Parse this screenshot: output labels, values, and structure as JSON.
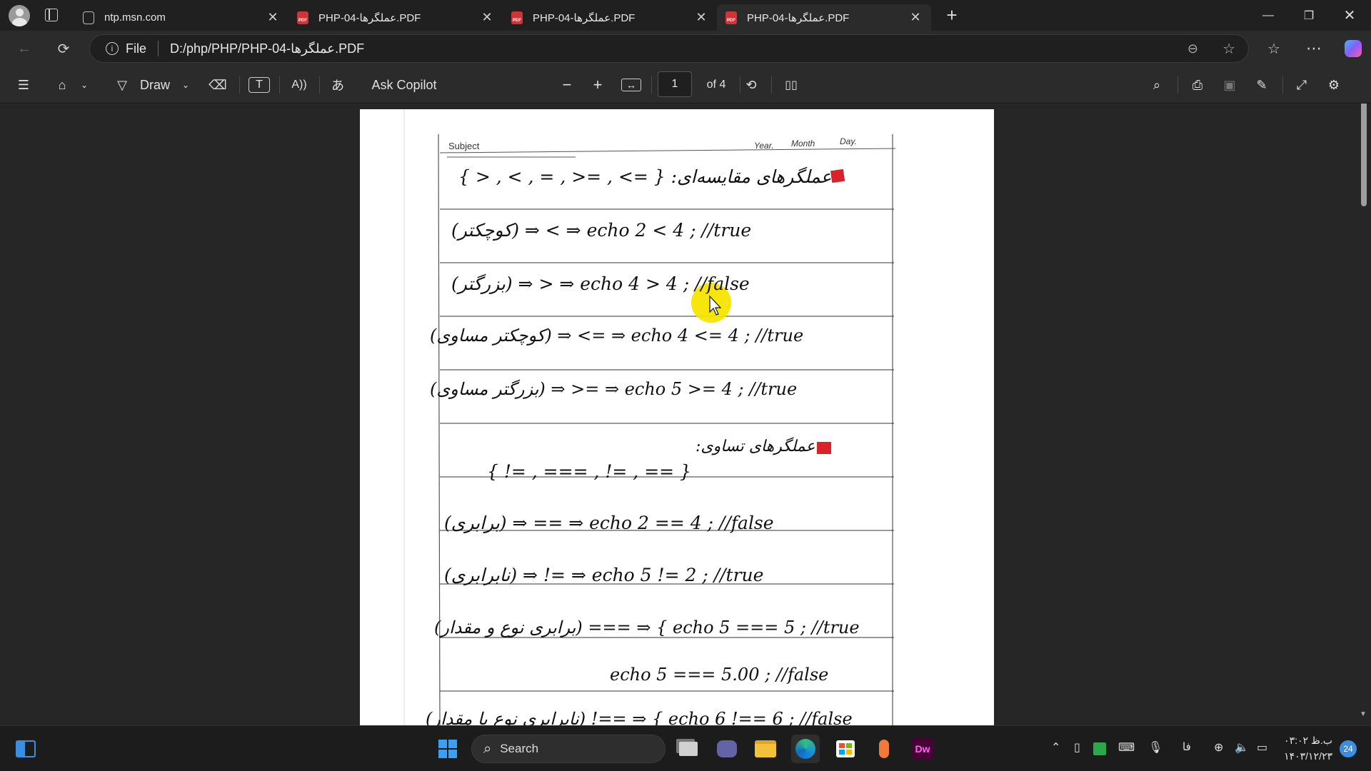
{
  "tabs": [
    {
      "title": "ntp.msn.com",
      "icon": "msn-icon",
      "active": false
    },
    {
      "title": "PHP-04-عملگرها.PDF",
      "icon": "pdf-icon",
      "active": false
    },
    {
      "title": "PHP-04-عملگرها.PDF",
      "icon": "pdf-icon",
      "active": false
    },
    {
      "title": "PHP-04-عملگرها.PDF",
      "icon": "pdf-icon",
      "active": true
    }
  ],
  "address": {
    "scheme_label": "File",
    "url": "D:/php/PHP/PHP-04-عملگرها.PDF"
  },
  "pdf_toolbar": {
    "draw_label": "Draw",
    "ask_copilot_label": "Ask Copilot",
    "page_number": "1",
    "page_total_label": "of 4"
  },
  "document": {
    "header": {
      "subject": "Subject",
      "year": "Year.",
      "month": "Month",
      "day": "Day."
    },
    "lines": [
      "{ > , < , = , >= , <= } :عملگرهای مقایسه‌ای",
      "(کوچکتر) ⇒ < ⇒ echo 2 < 4 ; //true",
      "(بزرگتر) ⇒ > ⇒ echo 4 > 4 ; //false",
      "(کوچکتر مساوی) ⇒ <= ⇒ echo 4 <= 4 ; //true",
      "(بزرگتر مساوی) ⇒ >= ⇒ echo 5 >= 4 ; //true",
      "",
      ":عملگرهای تساوی",
      "{ != , === , != , == }",
      "(برابری) ⇒ == ⇒ echo 2 == 4 ; //false",
      "(نابرابری) ⇒ != ⇒ echo 5 != 2 ; //true",
      "(برابری نوع و مقدار) === ⇒ { echo 5 === 5 ; //true",
      "echo 5 === 5.00 ; //false",
      "(نابرابری نوع یا مقدار) !== ⇒ { echo 6 !== 6 ; //false"
    ]
  },
  "taskbar": {
    "search_placeholder": "Search",
    "language": "فا",
    "time": "۰۳:۰۲ ب.ظ",
    "date": "۱۴۰۳/۱۲/۲۳",
    "notification_count": "24"
  },
  "colors": {
    "accent": "#0078d4",
    "pdf_red": "#d13438",
    "cursor_highlight": "#f6e500"
  }
}
